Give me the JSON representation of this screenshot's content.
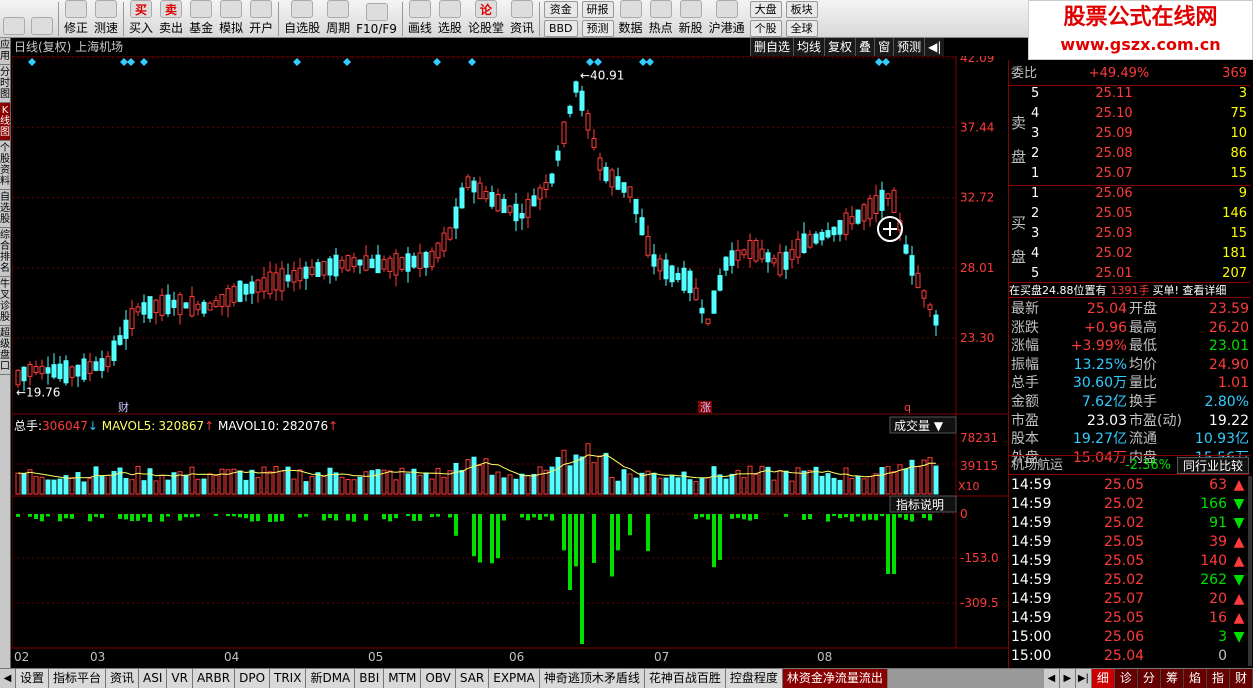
{
  "toolbar": {
    "buttons": [
      {
        "label": "",
        "icon": "arrow-left-icon"
      },
      {
        "label": "",
        "icon": "arrow-updown-icon"
      },
      {
        "label": "修正",
        "icon": "modify-icon"
      },
      {
        "label": "测速",
        "icon": "clock-icon"
      },
      {
        "label": "买入",
        "icon": "buy-icon",
        "glyph": "买"
      },
      {
        "label": "卖出",
        "icon": "sell-icon",
        "glyph": "卖"
      },
      {
        "label": "基金",
        "icon": "fund-icon"
      },
      {
        "label": "模拟",
        "icon": "hammer-icon"
      },
      {
        "label": "开户",
        "icon": "briefcase-icon"
      },
      {
        "label": "自选股",
        "icon": "star-icon"
      },
      {
        "label": "周期",
        "icon": "cycle-icon"
      },
      {
        "label": "F10/F9",
        "icon": "f10-icon"
      },
      {
        "label": "画线",
        "icon": "draw-icon"
      },
      {
        "label": "选股",
        "icon": "select-icon"
      },
      {
        "label": "论股堂",
        "icon": "forum-icon",
        "glyph": "论"
      },
      {
        "label": "资讯",
        "icon": "news-icon"
      }
    ],
    "stack1": [
      "资金",
      "BBD"
    ],
    "stack2": [
      "研报",
      "预测"
    ],
    "buttons2": [
      {
        "label": "数据",
        "icon": "pe-icon"
      },
      {
        "label": "热点",
        "icon": "hot-icon"
      },
      {
        "label": "新股",
        "icon": "ipo-icon"
      },
      {
        "label": "沪港通",
        "icon": "hk-icon"
      }
    ],
    "stack3": [
      "大盘",
      "个股"
    ],
    "stack4": [
      "板块",
      "全球"
    ]
  },
  "brand": {
    "line1": "股票公式在线网",
    "line2": "www.gszx.com.cn"
  },
  "left_tabs": [
    {
      "label": "应用",
      "active": false
    },
    {
      "label": "分时图",
      "active": false
    },
    {
      "label": "K线图",
      "active": true
    },
    {
      "label": "个股资料",
      "active": false
    },
    {
      "label": "自选股",
      "active": false
    },
    {
      "label": "综合排名",
      "active": false
    },
    {
      "label": "牛叉诊股",
      "active": false
    },
    {
      "label": "超级盘口",
      "active": false
    }
  ],
  "chart": {
    "title": "日线(复权)  上海机场",
    "tools": [
      "删自选",
      "均线",
      "复权",
      "叠",
      "窗",
      "预测"
    ],
    "price_axis": [
      "42.09",
      "37.44",
      "32.72",
      "28.01",
      "23.30"
    ],
    "high_label": "40.91",
    "low_label": "19.76",
    "markers": [
      "财",
      "涨",
      "q"
    ],
    "volume_header": {
      "total_label": "总手:",
      "total_value": "306047",
      "mavol5_label": "MAVOL5:",
      "mavol5_value": "320867",
      "mavol10_label": "MAVOL10:",
      "mavol10_value": "282076"
    },
    "volume_select": "成交量",
    "volume_axis": [
      "78231",
      "39115"
    ],
    "volume_unit": "X10",
    "indicator_button": "指标说明",
    "indicator_axis": [
      "0",
      "-153.0",
      "-309.5"
    ],
    "x_labels": [
      "02",
      "03",
      "04",
      "05",
      "06",
      "07",
      "08"
    ]
  },
  "right": {
    "weibi_label": "委比",
    "weibi_pct": "+49.49%",
    "weibi_val": "369",
    "sell_label": "卖盘",
    "sell": [
      {
        "n": "5",
        "price": "25.11",
        "vol": "3"
      },
      {
        "n": "4",
        "price": "25.10",
        "vol": "75"
      },
      {
        "n": "3",
        "price": "25.09",
        "vol": "10"
      },
      {
        "n": "2",
        "price": "25.08",
        "vol": "86"
      },
      {
        "n": "1",
        "price": "25.07",
        "vol": "15"
      }
    ],
    "buy_label": "买盘",
    "buy": [
      {
        "n": "1",
        "price": "25.06",
        "vol": "9"
      },
      {
        "n": "2",
        "price": "25.05",
        "vol": "146"
      },
      {
        "n": "3",
        "price": "25.03",
        "vol": "15"
      },
      {
        "n": "4",
        "price": "25.02",
        "vol": "181"
      },
      {
        "n": "5",
        "price": "25.01",
        "vol": "207"
      }
    ],
    "notice": {
      "text": "在买盘24.88位置有",
      "vol": "1391手",
      "tail": "买单! 查看详细"
    },
    "stats": [
      {
        "l1": "最新",
        "v1": "25.04",
        "l2": "开盘",
        "v2": "23.59"
      },
      {
        "l1": "涨跌",
        "v1": "+0.96",
        "l2": "最高",
        "v2": "26.20"
      },
      {
        "l1": "涨幅",
        "v1": "+3.99%",
        "l2": "最低",
        "v2": "23.01"
      },
      {
        "l1": "振幅",
        "v1": "13.25%",
        "l2": "均价",
        "v2": "24.90"
      },
      {
        "l1": "总手",
        "v1": "30.60万",
        "l2": "量比",
        "v2": "1.01"
      },
      {
        "l1": "金额",
        "v1": "7.62亿",
        "l2": "换手",
        "v2": "2.80%"
      },
      {
        "l1": "市盈",
        "v1": "23.03",
        "l2": "市盈(动)",
        "v2": "19.22"
      },
      {
        "l1": "股本",
        "v1": "19.27亿",
        "l2": "流通",
        "v2": "10.93亿"
      },
      {
        "l1": "外盘",
        "v1": "15.04万",
        "l2": "内盘",
        "v2": "15.56万"
      }
    ],
    "sector": {
      "name": "机场航运",
      "pct": "-2.36%",
      "button": "同行业比较"
    },
    "ticks": [
      {
        "time": "14:59",
        "price": "25.05",
        "vol": "63",
        "dir": "up"
      },
      {
        "time": "14:59",
        "price": "25.02",
        "vol": "166",
        "dir": "down"
      },
      {
        "time": "14:59",
        "price": "25.02",
        "vol": "91",
        "dir": "down"
      },
      {
        "time": "14:59",
        "price": "25.05",
        "vol": "39",
        "dir": "up"
      },
      {
        "time": "14:59",
        "price": "25.05",
        "vol": "140",
        "dir": "up"
      },
      {
        "time": "14:59",
        "price": "25.02",
        "vol": "262",
        "dir": "down"
      },
      {
        "time": "14:59",
        "price": "25.07",
        "vol": "20",
        "dir": "up"
      },
      {
        "time": "14:59",
        "price": "25.05",
        "vol": "16",
        "dir": "up"
      },
      {
        "time": "15:00",
        "price": "25.06",
        "vol": "3",
        "dir": "down"
      },
      {
        "time": "15:00",
        "price": "25.04",
        "vol": "0",
        "dir": "none"
      }
    ]
  },
  "bottom_tabs": [
    "设置",
    "指标平台",
    "资讯",
    "ASI",
    "VR",
    "ARBR",
    "DPO",
    "TRIX",
    "新DMA",
    "BBI",
    "MTM",
    "OBV",
    "SAR",
    "EXPMA",
    "神奇逃顶木矛盾线",
    "花神百战百胜",
    "控盘程度",
    "林资金净流量流出"
  ],
  "bottom_active": "林资金净流量流出",
  "right_tabs": [
    "细",
    "诊",
    "分",
    "筹",
    "焰",
    "指",
    "财"
  ],
  "right_active": "细",
  "colors": {
    "up": "#ff3b3b",
    "down": "#54ffff",
    "ma": "#ffff66",
    "indicator": "#00e000",
    "axis": "#800000"
  }
}
